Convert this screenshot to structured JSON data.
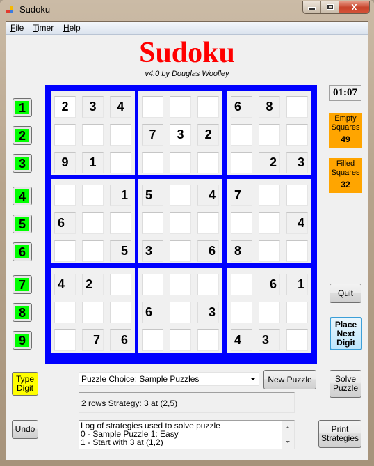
{
  "window": {
    "title": "Sudoku",
    "min_glyph": "minimize",
    "max_glyph": "maximize",
    "close_glyph": "X"
  },
  "menu": [
    {
      "accel": "F",
      "rest": "ile"
    },
    {
      "accel": "T",
      "rest": "imer"
    },
    {
      "accel": "H",
      "rest": "elp"
    }
  ],
  "header": {
    "title": "Sudoku",
    "subtitle": "v4.0 by Douglas Woolley"
  },
  "digit_buttons": [
    "1",
    "2",
    "3",
    "4",
    "5",
    "6",
    "7",
    "8",
    "9"
  ],
  "board": {
    "rows": [
      [
        "2",
        "3",
        "4",
        "",
        "",
        "",
        "6",
        "8",
        ""
      ],
      [
        "",
        "",
        "",
        "7",
        "3",
        "2",
        "",
        "",
        ""
      ],
      [
        "9",
        "1",
        "",
        "",
        "",
        "",
        "",
        "2",
        "3"
      ],
      [
        "",
        "",
        "1",
        "5",
        "",
        "4",
        "7",
        "",
        ""
      ],
      [
        "6",
        "",
        "",
        "",
        "",
        "",
        "",
        "",
        "4"
      ],
      [
        "",
        "",
        "5",
        "3",
        "",
        "6",
        "8",
        "",
        ""
      ],
      [
        "4",
        "2",
        "",
        "",
        "",
        "",
        "",
        "6",
        "1"
      ],
      [
        "",
        "",
        "",
        "6",
        "",
        "3",
        "",
        "",
        ""
      ],
      [
        "",
        "7",
        "6",
        "",
        "",
        "",
        "4",
        "3",
        ""
      ]
    ],
    "user_filled": [
      [
        0,
        0
      ],
      [
        1,
        4
      ]
    ]
  },
  "timer": "01:07",
  "stats": {
    "empty_label": "Empty Squares",
    "empty_value": "49",
    "filled_label": "Filled Squares",
    "filled_value": "32"
  },
  "buttons": {
    "quit": "Quit",
    "place_next_digit": "Place Next Digit",
    "type_digit": "Type Digit",
    "new_puzzle": "New Puzzle",
    "solve_puzzle": "Solve Puzzle",
    "undo": "Undo",
    "print_strategies": "Print Strategies"
  },
  "puzzle_choice": {
    "selected": "Puzzle Choice: Sample Puzzles"
  },
  "status_text": "2 rows Strategy: 3 at (2,5)",
  "log": [
    "Log of strategies used to solve puzzle",
    "0 - Sample Puzzle 1: Easy",
    "1 - Start with 3 at (1,2)"
  ],
  "colors": {
    "title_red": "#ff0000",
    "board_blue": "#0000ff",
    "digit_green": "#00ff00",
    "stat_orange": "#ffa500",
    "type_digit_yellow": "#ffff00"
  }
}
